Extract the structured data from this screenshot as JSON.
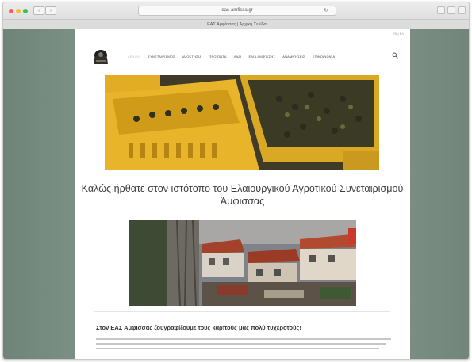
{
  "browser": {
    "url": "eas-amfissa.gr",
    "tab_title": "ΕΑΣ Αμφίσσας | Αρχική Σελίδα",
    "back_label": "‹",
    "forward_label": "›",
    "reload_label": "↻"
  },
  "site": {
    "top_strip": "EN | ΕΛ",
    "nav": [
      "Αρχική",
      "Συνεταιρισμός",
      "Ιδιοκτησία",
      "Προϊόντα",
      "Λάδι",
      "Ελιά Αμφίσσης",
      "Αναμνήσεις",
      "Επικοινωνία"
    ],
    "welcome_heading": "Καλώς ήρθατε στον ιστότοπο του Ελαιουργικού Αγροτικού Συνεταιρισμού Άμφισσας",
    "section_heading": "Στον ΕΑΣ Άμφισσας ζουγραφίζουμε τους καρπούς μας πολύ τυχεροτούς!"
  },
  "colors": {
    "crate_yellow": "#e8b429",
    "olive_dark": "#2f3322",
    "page_bg": "#8fa398"
  }
}
